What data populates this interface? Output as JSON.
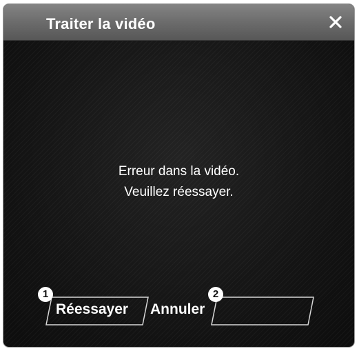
{
  "dialog": {
    "title": "Traiter la vidéo",
    "close_icon": "close-icon"
  },
  "message": {
    "line1": "Erreur dans la vidéo.",
    "line2": "Veuillez réessayer."
  },
  "buttons": {
    "retry_label": "Réessayer",
    "cancel_label": "Annuler"
  },
  "callouts": {
    "first": "1",
    "second": "2"
  }
}
